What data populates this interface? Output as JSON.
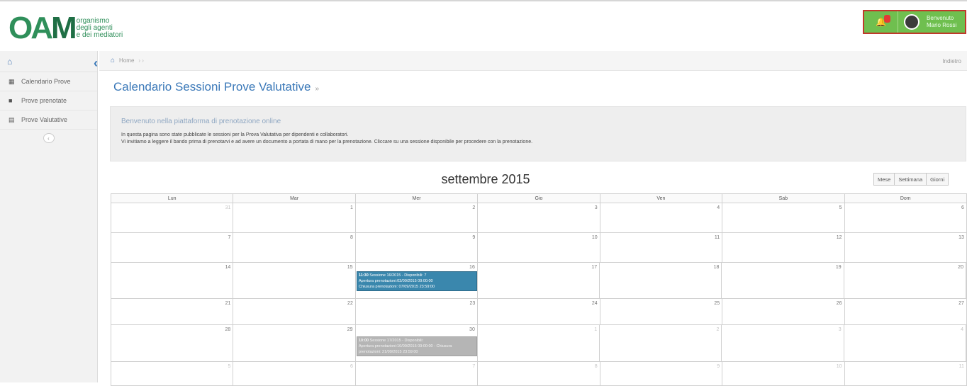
{
  "logo": {
    "mark_o": "O",
    "mark_a": "A",
    "mark_m": "M",
    "line1": "organismo",
    "line2": "degli agenti",
    "line3": "e dei mediatori"
  },
  "user": {
    "badge_count": "1",
    "greeting": "Benvenuto",
    "name": "Mario Rossi"
  },
  "sidebar": {
    "items": [
      {
        "label": "Calendario Prove",
        "icon": "calendar-icon"
      },
      {
        "label": "Prove prenotate",
        "icon": "bookmark-icon"
      },
      {
        "label": "Prove Valutative",
        "icon": "list-icon"
      }
    ]
  },
  "breadcrumb": {
    "home": "Home",
    "right": "Indietro"
  },
  "page": {
    "title": "Calendario Sessioni Prove Valutative",
    "title_arrow": "»"
  },
  "welcome": {
    "title": "Benvenuto nella piattaforma di prenotazione online",
    "line1": "In questa pagina sono state pubblicate le sessioni per la Prova Valutativa per dipendenti e collaboratori.",
    "line2": "Vi invitiamo a leggere il bando prima di prenotarvi e ad avere un documento a portata di mano per la prenotazione. Cliccare su una sessione disponibile per procedere con la prenotazione."
  },
  "calendar": {
    "month_title": "settembre 2015",
    "views": [
      "Mese",
      "Settimana",
      "Giorni"
    ],
    "weekdays": [
      "Lun",
      "Mar",
      "Mer",
      "Gio",
      "Ven",
      "Sab",
      "Dom"
    ],
    "weeks": [
      [
        {
          "n": "31",
          "other": true
        },
        {
          "n": "1"
        },
        {
          "n": "2"
        },
        {
          "n": "3"
        },
        {
          "n": "4"
        },
        {
          "n": "5"
        },
        {
          "n": "6"
        }
      ],
      [
        {
          "n": "7"
        },
        {
          "n": "8"
        },
        {
          "n": "9"
        },
        {
          "n": "10"
        },
        {
          "n": "11"
        },
        {
          "n": "12"
        },
        {
          "n": "13"
        }
      ],
      [
        {
          "n": "14"
        },
        {
          "n": "15"
        },
        {
          "n": "16"
        },
        {
          "n": "17"
        },
        {
          "n": "18"
        },
        {
          "n": "19"
        },
        {
          "n": "20"
        }
      ],
      [
        {
          "n": "21"
        },
        {
          "n": "22"
        },
        {
          "n": "23"
        },
        {
          "n": "24"
        },
        {
          "n": "25"
        },
        {
          "n": "26"
        },
        {
          "n": "27"
        }
      ],
      [
        {
          "n": "28"
        },
        {
          "n": "29"
        },
        {
          "n": "30"
        },
        {
          "n": "1",
          "other": true
        },
        {
          "n": "2",
          "other": true
        },
        {
          "n": "3",
          "other": true
        },
        {
          "n": "4",
          "other": true
        }
      ],
      [
        {
          "n": "5",
          "other": true
        },
        {
          "n": "6",
          "other": true
        },
        {
          "n": "7",
          "other": true
        },
        {
          "n": "8",
          "other": true
        },
        {
          "n": "9",
          "other": true
        },
        {
          "n": "10",
          "other": true
        },
        {
          "n": "11",
          "other": true
        }
      ]
    ],
    "events": [
      {
        "time": "11:30",
        "line1": "Sessione 16/2015 - Disponibili: 7",
        "line2": "Apertura prenotazioni:03/09/2015 09:00:00",
        "line3": "Chiusura prenotazioni: 07/09/2015 23:59:00",
        "style": "blue"
      },
      {
        "time": "10:00",
        "line1": "Sessione 17/2015 - Disponibili:",
        "line2": "Apertura prenotazioni:10/09/2015 09:00:00 - Chiusura",
        "line3": "prenotazioni: 21/09/2015 23:59:00",
        "style": "grey"
      }
    ]
  },
  "colors": {
    "brand_green": "#2f8f5a",
    "accent_blue": "#3a78b8",
    "event_blue": "#3a87ad",
    "event_grey": "#b5b5b5",
    "user_bar": "#6fbf4f",
    "highlight_border": "#c0392b"
  }
}
